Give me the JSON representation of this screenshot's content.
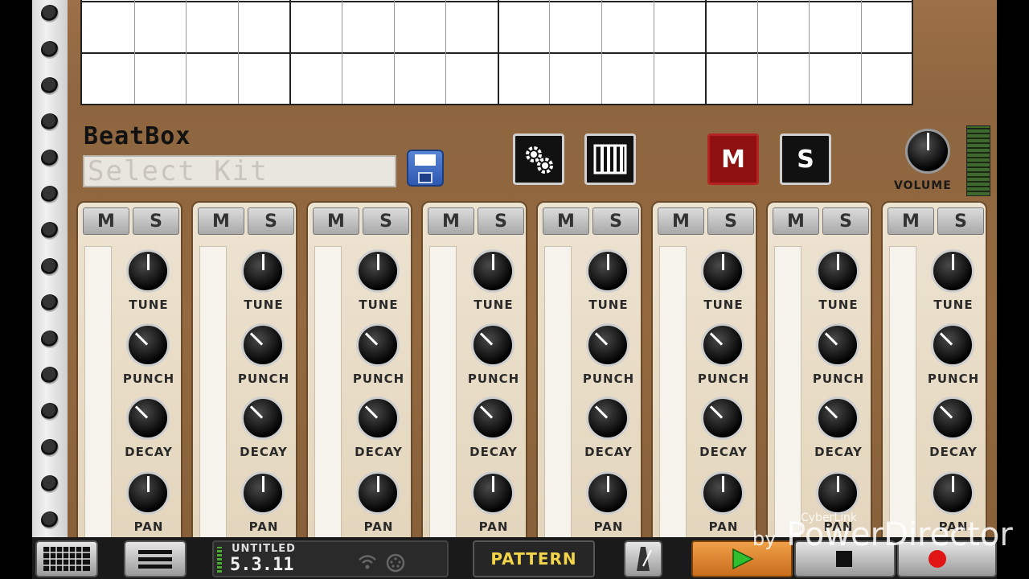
{
  "app": {
    "title": "BeatBox",
    "kit_display": "Select Kit"
  },
  "top_buttons": {
    "settings_icon": "gear-icon",
    "mixer_icon": "bars-icon",
    "mute_all_label": "M",
    "solo_all_label": "S"
  },
  "volume": {
    "label": "VOLUME"
  },
  "channels": [
    {
      "mute": "M",
      "solo": "S",
      "tune": "TUNE",
      "punch": "PUNCH",
      "decay": "DECAY",
      "pan": "PAN"
    },
    {
      "mute": "M",
      "solo": "S",
      "tune": "TUNE",
      "punch": "PUNCH",
      "decay": "DECAY",
      "pan": "PAN"
    },
    {
      "mute": "M",
      "solo": "S",
      "tune": "TUNE",
      "punch": "PUNCH",
      "decay": "DECAY",
      "pan": "PAN"
    },
    {
      "mute": "M",
      "solo": "S",
      "tune": "TUNE",
      "punch": "PUNCH",
      "decay": "DECAY",
      "pan": "PAN"
    },
    {
      "mute": "M",
      "solo": "S",
      "tune": "TUNE",
      "punch": "PUNCH",
      "decay": "DECAY",
      "pan": "PAN"
    },
    {
      "mute": "M",
      "solo": "S",
      "tune": "TUNE",
      "punch": "PUNCH",
      "decay": "DECAY",
      "pan": "PAN"
    },
    {
      "mute": "M",
      "solo": "S",
      "tune": "TUNE",
      "punch": "PUNCH",
      "decay": "DECAY",
      "pan": "PAN"
    },
    {
      "mute": "M",
      "solo": "S",
      "tune": "TUNE",
      "punch": "PUNCH",
      "decay": "DECAY",
      "pan": "PAN"
    }
  ],
  "toolbar": {
    "song_name": "UNTITLED",
    "song_position": "5.3.11",
    "pattern_label": "PATTERN"
  },
  "watermark": {
    "small": "CyberLink",
    "by": "by",
    "big": "PowerDirector"
  }
}
